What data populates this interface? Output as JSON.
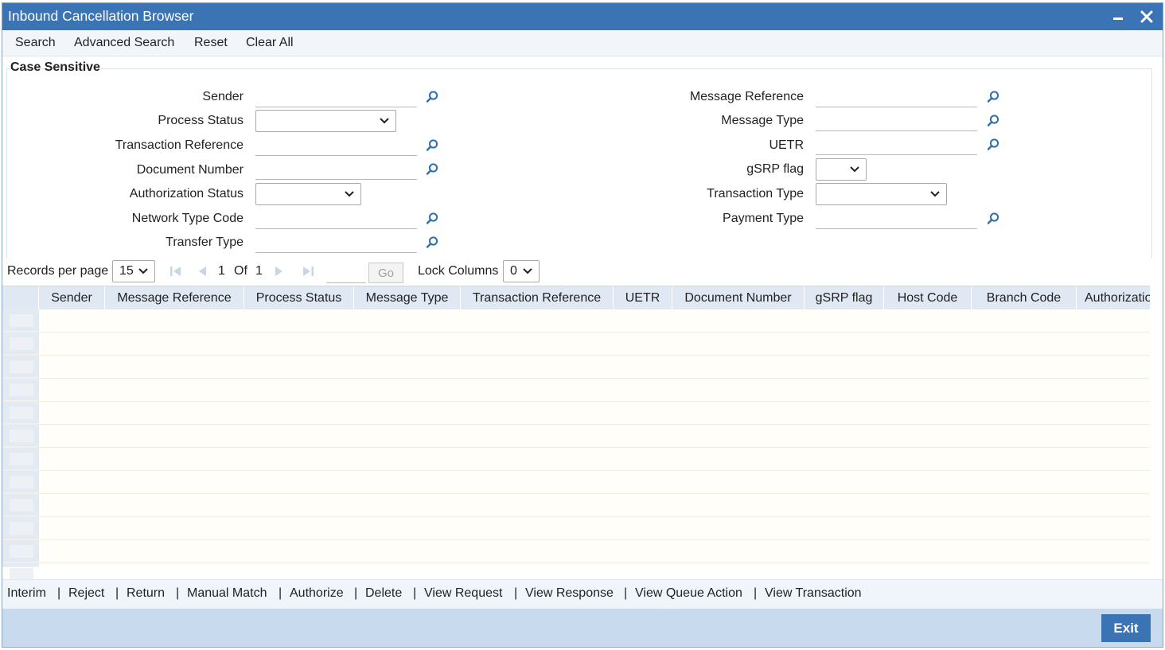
{
  "window": {
    "title": "Inbound Cancellation Browser"
  },
  "menu": {
    "search": "Search",
    "advanced_search": "Advanced Search",
    "reset": "Reset",
    "clear_all": "Clear All"
  },
  "search_panel": {
    "legend": "Case Sensitive",
    "sender": "Sender",
    "process_status": "Process Status",
    "transaction_reference": "Transaction Reference",
    "document_number": "Document Number",
    "authorization_status": "Authorization Status",
    "network_type_code": "Network Type Code",
    "transfer_type": "Transfer Type",
    "message_reference": "Message Reference",
    "message_type": "Message Type",
    "uetr": "UETR",
    "gsrp_flag": "gSRP flag",
    "transaction_type": "Transaction Type",
    "payment_type": "Payment Type"
  },
  "pagination": {
    "records_per_page_label": "Records per page",
    "records_per_page": "15",
    "current_page": "1",
    "of_label": "Of",
    "total_pages": "1",
    "go_label": "Go",
    "lock_columns_label": "Lock Columns",
    "lock_columns": "0"
  },
  "grid": {
    "columns": [
      "Sender",
      "Message Reference",
      "Process Status",
      "Message Type",
      "Transaction Reference",
      "UETR",
      "Document Number",
      "gSRP flag",
      "Host Code",
      "Branch Code",
      "Authorizatio"
    ]
  },
  "actions": {
    "separator": "|",
    "items": [
      "Interim",
      "Reject",
      "Return",
      "Manual Match",
      "Authorize",
      "Delete",
      "View Request",
      "View Response",
      "View Queue Action",
      "View Transaction"
    ]
  },
  "footer": {
    "exit": "Exit"
  },
  "colors": {
    "brand": "#3b74b5",
    "footer": "#c8daee",
    "header_row": "#dfe8f3"
  }
}
